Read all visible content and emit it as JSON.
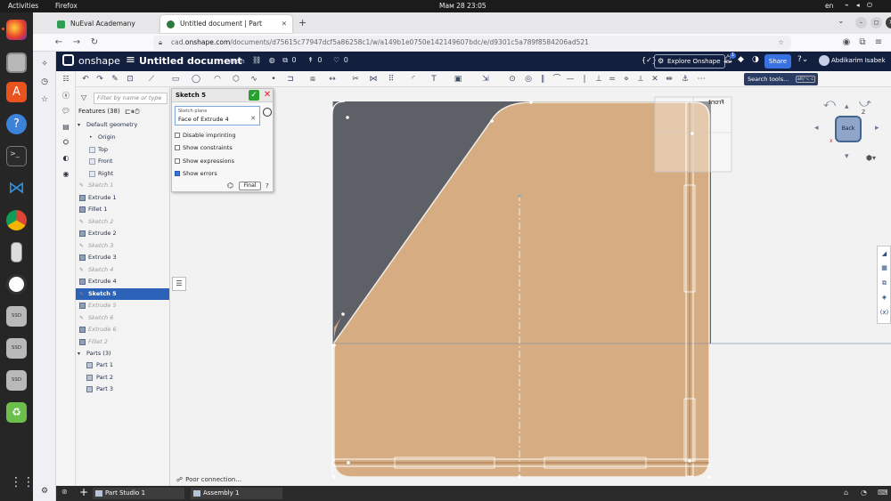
{
  "gnome": {
    "activities": "Activities",
    "app_name": "Firefox",
    "clock": "Мам 28  23:05",
    "lang": "en"
  },
  "browser": {
    "tabs": [
      {
        "title": "NuEval Academany",
        "active": false
      },
      {
        "title": "Untitled document | Part",
        "active": true
      }
    ],
    "url_prefix": "cad.",
    "url_domain": "onshape.com",
    "url_path": "/documents/d75615c77947dcf5a86258c1/w/a149b1e0750e142149607bdc/e/d9301c5a789f8584206ad521"
  },
  "onshape": {
    "brand": "onshape",
    "doc_title": "Untitled document",
    "workspace": "Main",
    "versions_count": "0",
    "branches_count": "0",
    "likes_count": "0",
    "explore": "Explore Onshape",
    "notif_count": "1",
    "share": "Share",
    "user": "Abdikarim Isabek",
    "search_tools": "Search tools...",
    "search_shortcut": "alt/⌥ c"
  },
  "feature_list": {
    "filter_placeholder": "Filter by name or type",
    "header": "Features (38)",
    "default_geometry": "Default geometry",
    "items": [
      {
        "label": "Origin",
        "type": "origin",
        "state": "normal",
        "indent": 2
      },
      {
        "label": "Top",
        "type": "plane",
        "state": "normal",
        "indent": 2
      },
      {
        "label": "Front",
        "type": "plane",
        "state": "normal",
        "indent": 2
      },
      {
        "label": "Right",
        "type": "plane",
        "state": "normal",
        "indent": 2
      },
      {
        "label": "Sketch 1",
        "type": "sketch",
        "state": "muted",
        "indent": 1
      },
      {
        "label": "Extrude 1",
        "type": "feature",
        "state": "normal",
        "indent": 1
      },
      {
        "label": "Fillet 1",
        "type": "feature",
        "state": "normal",
        "indent": 1
      },
      {
        "label": "Sketch 2",
        "type": "sketch",
        "state": "muted",
        "indent": 1
      },
      {
        "label": "Extrude 2",
        "type": "feature",
        "state": "normal",
        "indent": 1
      },
      {
        "label": "Sketch 3",
        "type": "sketch",
        "state": "muted",
        "indent": 1
      },
      {
        "label": "Extrude 3",
        "type": "feature",
        "state": "normal",
        "indent": 1
      },
      {
        "label": "Sketch 4",
        "type": "sketch",
        "state": "muted",
        "indent": 1
      },
      {
        "label": "Extrude 4",
        "type": "feature",
        "state": "normal",
        "indent": 1
      },
      {
        "label": "Sketch 5",
        "type": "sketch",
        "state": "selected",
        "indent": 1
      },
      {
        "label": "Extrude 5",
        "type": "feature",
        "state": "muted",
        "indent": 1
      },
      {
        "label": "Sketch 6",
        "type": "sketch",
        "state": "muted",
        "indent": 1
      },
      {
        "label": "Extrude 6",
        "type": "feature",
        "state": "muted",
        "indent": 1
      },
      {
        "label": "Fillet 2",
        "type": "feature",
        "state": "muted",
        "indent": 1
      }
    ],
    "parts_header": "Parts (3)",
    "parts": [
      "Part 1",
      "Part 2",
      "Part 3"
    ]
  },
  "sketch_dialog": {
    "title": "Sketch 5",
    "plane_label": "Sketch plane",
    "plane_value": "Face of Extrude 4",
    "options": [
      {
        "label": "Disable imprinting",
        "checked": false
      },
      {
        "label": "Show constraints",
        "checked": false
      },
      {
        "label": "Show expressions",
        "checked": false
      },
      {
        "label": "Show errors",
        "checked": true
      }
    ],
    "final_label": "Final"
  },
  "viewport": {
    "view_cube_label": "Back",
    "plane_label": "Front",
    "status": "Poor connection..."
  },
  "bottom_tabs": {
    "part_studio": "Part Studio 1",
    "assembly": "Assembly 1"
  },
  "colors": {
    "onshape_header": "#121f3e",
    "selected_row": "#2c62b7",
    "part_face": "#d6ac82",
    "sketch_region": "#5a5d63",
    "share_button": "#3871e0"
  }
}
